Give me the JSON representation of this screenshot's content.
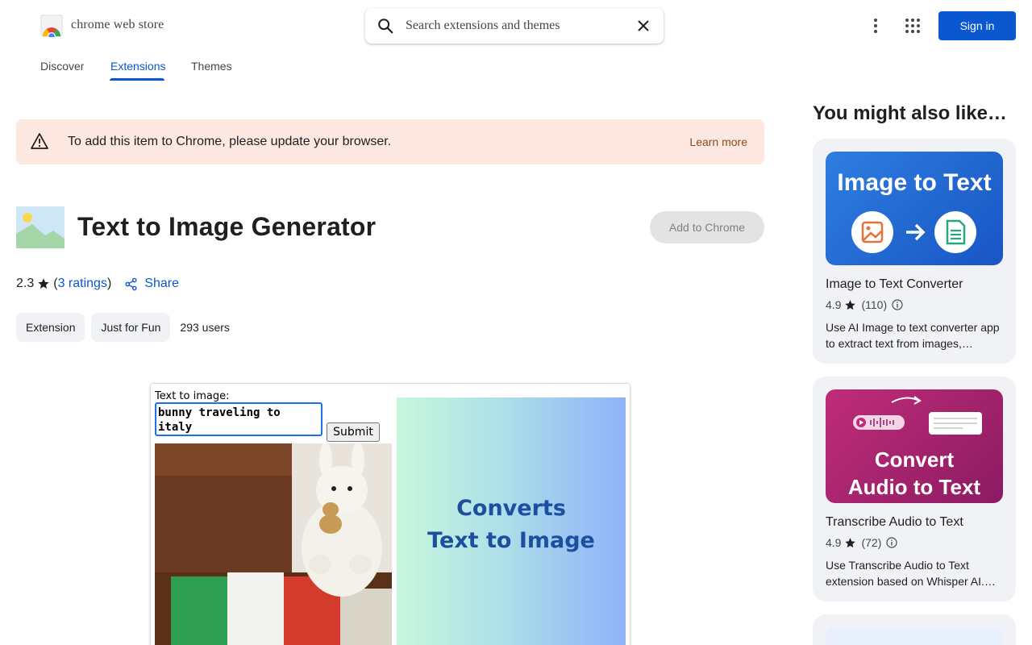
{
  "header": {
    "brand": "chrome web store",
    "search_placeholder": "Search extensions and themes",
    "signin": "Sign in"
  },
  "nav": {
    "tabs": [
      {
        "label": "Discover",
        "active": false
      },
      {
        "label": "Extensions",
        "active": true
      },
      {
        "label": "Themes",
        "active": false
      }
    ]
  },
  "banner": {
    "message": "To add this item to Chrome, please update your browser.",
    "link": "Learn more",
    "color": "#fce8e0"
  },
  "item": {
    "title": "Text to Image Generator",
    "add_button": "Add to Chrome",
    "rating": "2.3",
    "ratings_open": "(",
    "ratings_link": "3 ratings",
    "ratings_close": ")",
    "share": "Share",
    "chips": [
      "Extension",
      "Just for Fun"
    ],
    "users": "293 users"
  },
  "preview": {
    "label": "Text to image:",
    "textarea_value": "bunny traveling to italy",
    "submit": "Submit",
    "promo_line1": "Converts",
    "promo_line2": "Text to Image"
  },
  "sidebar": {
    "title": "You might also like…",
    "cards": [
      {
        "image_text": "Image to Text",
        "name": "Image to Text Converter",
        "rating": "4.9",
        "count": "(110)",
        "description": "Use AI Image to text converter app to extract text from images,…"
      },
      {
        "image_text_line1": "Convert",
        "image_text_line2": "Audio to Text",
        "name": "Transcribe Audio to Text",
        "rating": "4.9",
        "count": "(72)",
        "description": "Use Transcribe Audio to Text extension based on Whisper AI.…"
      }
    ]
  },
  "colors": {
    "accent": "#0b57d0",
    "chip_bg": "#f0f2f5"
  }
}
